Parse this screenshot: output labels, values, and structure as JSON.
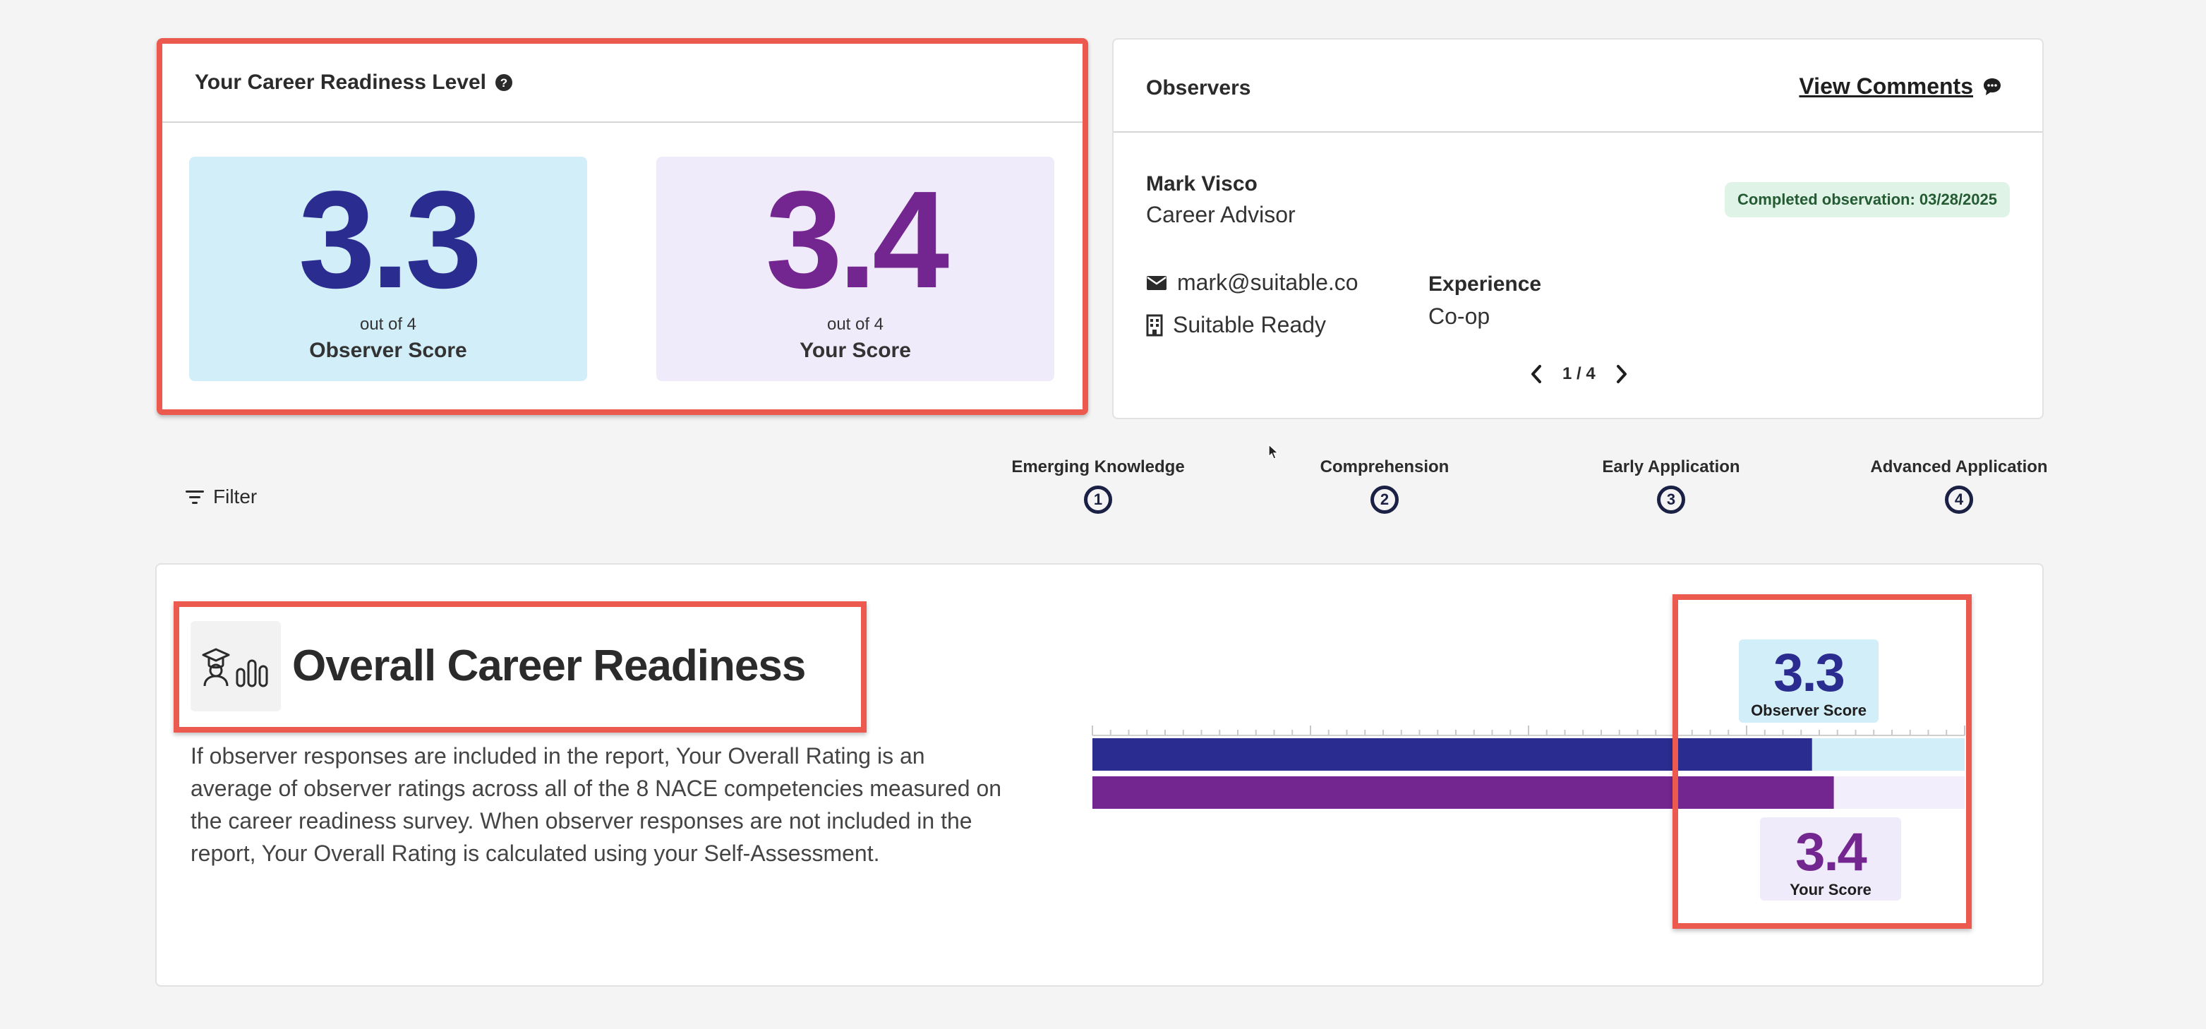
{
  "readiness": {
    "title": "Your Career Readiness Level",
    "observer_score": "3.3",
    "observer_out_of": "out of 4",
    "observer_label": "Observer Score",
    "your_score": "3.4",
    "your_out_of": "out of 4",
    "your_label": "Your Score"
  },
  "observers": {
    "title": "Observers",
    "view_comments": "View Comments",
    "name": "Mark Visco",
    "role": "Career Advisor",
    "badge": "Completed observation: 03/28/2025",
    "email": "mark@suitable.co",
    "org": "Suitable Ready",
    "experience_label": "Experience",
    "experience_value": "Co-op",
    "pager": "1 / 4"
  },
  "filter": {
    "label": "Filter"
  },
  "levels": [
    {
      "name": "Emerging Knowledge",
      "num": "1"
    },
    {
      "name": "Comprehension",
      "num": "2"
    },
    {
      "name": "Early Application",
      "num": "3"
    },
    {
      "name": "Advanced Application",
      "num": "4"
    }
  ],
  "overall": {
    "title": "Overall Career Readiness",
    "description": "If observer responses are included in the report, Your Overall Rating is an average of observer ratings across all of the 8 NACE competencies measured on the career readiness survey. When observer responses are not included in the report, Your Overall Rating is calculated using your Self-Assessment."
  },
  "chart_data": {
    "type": "bar",
    "orientation": "horizontal",
    "xlim": [
      0,
      4
    ],
    "series": [
      {
        "name": "Observer Score",
        "value": 3.3,
        "display": "3.3",
        "color": "#2a2d8f",
        "track": "#d2eef9",
        "label_bg": "#d2eef9"
      },
      {
        "name": "Your Score",
        "value": 3.4,
        "display": "3.4",
        "color": "#73268f",
        "track": "#f3eefc",
        "label_bg": "#f0ebfb"
      }
    ]
  },
  "colors": {
    "highlight": "#ec5a4f",
    "observer": "#2a2d8f",
    "you": "#73268f",
    "observer_bg": "#d2eef9",
    "you_bg": "#f0ebfb"
  }
}
